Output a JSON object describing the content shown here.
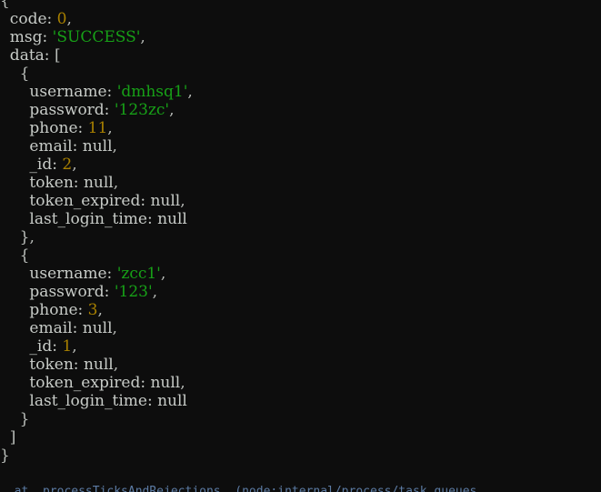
{
  "terminal": {
    "background_color": "#0d0d0d",
    "key_color": "#c8ccc8",
    "string_color": "#17a017",
    "number_color": "#a88000",
    "punctuation_color": "#b9bdb9",
    "clipped_line_color": "#6a8fbf"
  },
  "response": {
    "open_brace": "{",
    "close_brace": "}",
    "code": {
      "key": "  code:",
      "value": "0",
      "comma": ","
    },
    "msg": {
      "key": "  msg:",
      "quote_open": "'",
      "value": "SUCCESS",
      "quote_close": "'",
      "comma": ","
    },
    "data": {
      "key": "  data:",
      "open_bracket": "[",
      "close_bracket": "  ]",
      "records": [
        {
          "open_brace": "    {",
          "close_brace": "    },",
          "fields": [
            {
              "indent": "      ",
              "key": "username:",
              "value": "'dmhsq1'",
              "type": "string",
              "comma": ","
            },
            {
              "indent": "      ",
              "key": "password:",
              "value": "'123zc'",
              "type": "string",
              "comma": ","
            },
            {
              "indent": "      ",
              "key": "phone:",
              "value": "11",
              "type": "number",
              "comma": ","
            },
            {
              "indent": "      ",
              "key": "email:",
              "value": "null",
              "type": "null",
              "comma": ","
            },
            {
              "indent": "      ",
              "key": "_id:",
              "value": "2",
              "type": "number",
              "comma": ","
            },
            {
              "indent": "      ",
              "key": "token:",
              "value": "null",
              "type": "null",
              "comma": ","
            },
            {
              "indent": "      ",
              "key": "token_expired:",
              "value": "null",
              "type": "null",
              "comma": ","
            },
            {
              "indent": "      ",
              "key": "last_login_time:",
              "value": "null",
              "type": "null",
              "comma": ""
            }
          ]
        },
        {
          "open_brace": "    {",
          "close_brace": "    }",
          "fields": [
            {
              "indent": "      ",
              "key": "username:",
              "value": "'zcc1'",
              "type": "string",
              "comma": ","
            },
            {
              "indent": "      ",
              "key": "password:",
              "value": "'123'",
              "type": "string",
              "comma": ","
            },
            {
              "indent": "      ",
              "key": "phone:",
              "value": "3",
              "type": "number",
              "comma": ","
            },
            {
              "indent": "      ",
              "key": "email:",
              "value": "null",
              "type": "null",
              "comma": ","
            },
            {
              "indent": "      ",
              "key": "_id:",
              "value": "1",
              "type": "number",
              "comma": ","
            },
            {
              "indent": "      ",
              "key": "token:",
              "value": "null",
              "type": "null",
              "comma": ","
            },
            {
              "indent": "      ",
              "key": "token_expired:",
              "value": "null",
              "type": "null",
              "comma": ","
            },
            {
              "indent": "      ",
              "key": "last_login_time:",
              "value": "null",
              "type": "null",
              "comma": ""
            }
          ]
        }
      ]
    }
  },
  "lines": [
    {
      "id": "l0",
      "parts": [
        {
          "t": "{",
          "c": "brace"
        }
      ]
    },
    {
      "id": "l1",
      "parts": [
        {
          "t": "  code: ",
          "c": "key"
        },
        {
          "t": "0",
          "c": "num"
        },
        {
          "t": ",",
          "c": "punc"
        }
      ]
    },
    {
      "id": "l2",
      "parts": [
        {
          "t": "  msg: ",
          "c": "key"
        },
        {
          "t": "'SUCCESS'",
          "c": "str"
        },
        {
          "t": ",",
          "c": "punc"
        }
      ]
    },
    {
      "id": "l3",
      "parts": [
        {
          "t": "  data: ",
          "c": "key"
        },
        {
          "t": "[",
          "c": "brace"
        }
      ]
    },
    {
      "id": "l4",
      "parts": [
        {
          "t": "    {",
          "c": "brace"
        }
      ]
    },
    {
      "id": "l5",
      "parts": [
        {
          "t": "      username: ",
          "c": "key"
        },
        {
          "t": "'dmhsq1'",
          "c": "str"
        },
        {
          "t": ",",
          "c": "punc"
        }
      ]
    },
    {
      "id": "l6",
      "parts": [
        {
          "t": "      password: ",
          "c": "key"
        },
        {
          "t": "'123zc'",
          "c": "str"
        },
        {
          "t": ",",
          "c": "punc"
        }
      ]
    },
    {
      "id": "l7",
      "parts": [
        {
          "t": "      phone: ",
          "c": "key"
        },
        {
          "t": "11",
          "c": "num"
        },
        {
          "t": ",",
          "c": "punc"
        }
      ]
    },
    {
      "id": "l8",
      "parts": [
        {
          "t": "      email: ",
          "c": "key"
        },
        {
          "t": "null",
          "c": "nul"
        },
        {
          "t": ",",
          "c": "punc"
        }
      ]
    },
    {
      "id": "l9",
      "parts": [
        {
          "t": "      _id: ",
          "c": "key"
        },
        {
          "t": "2",
          "c": "num"
        },
        {
          "t": ",",
          "c": "punc"
        }
      ]
    },
    {
      "id": "l10",
      "parts": [
        {
          "t": "      token: ",
          "c": "key"
        },
        {
          "t": "null",
          "c": "nul"
        },
        {
          "t": ",",
          "c": "punc"
        }
      ]
    },
    {
      "id": "l11",
      "parts": [
        {
          "t": "      token_expired: ",
          "c": "key"
        },
        {
          "t": "null",
          "c": "nul"
        },
        {
          "t": ",",
          "c": "punc"
        }
      ]
    },
    {
      "id": "l12",
      "parts": [
        {
          "t": "      last_login_time: ",
          "c": "key"
        },
        {
          "t": "null",
          "c": "nul"
        }
      ]
    },
    {
      "id": "l13",
      "parts": [
        {
          "t": "    }",
          "c": "brace"
        },
        {
          "t": ",",
          "c": "punc"
        }
      ]
    },
    {
      "id": "l14",
      "parts": [
        {
          "t": "    {",
          "c": "brace"
        }
      ]
    },
    {
      "id": "l15",
      "parts": [
        {
          "t": "      username: ",
          "c": "key"
        },
        {
          "t": "'zcc1'",
          "c": "str"
        },
        {
          "t": ",",
          "c": "punc"
        }
      ]
    },
    {
      "id": "l16",
      "parts": [
        {
          "t": "      password: ",
          "c": "key"
        },
        {
          "t": "'123'",
          "c": "str"
        },
        {
          "t": ",",
          "c": "punc"
        }
      ]
    },
    {
      "id": "l17",
      "parts": [
        {
          "t": "      phone: ",
          "c": "key"
        },
        {
          "t": "3",
          "c": "num"
        },
        {
          "t": ",",
          "c": "punc"
        }
      ]
    },
    {
      "id": "l18",
      "parts": [
        {
          "t": "      email: ",
          "c": "key"
        },
        {
          "t": "null",
          "c": "nul"
        },
        {
          "t": ",",
          "c": "punc"
        }
      ]
    },
    {
      "id": "l19",
      "parts": [
        {
          "t": "      _id: ",
          "c": "key"
        },
        {
          "t": "1",
          "c": "num"
        },
        {
          "t": ",",
          "c": "punc"
        }
      ]
    },
    {
      "id": "l20",
      "parts": [
        {
          "t": "      token: ",
          "c": "key"
        },
        {
          "t": "null",
          "c": "nul"
        },
        {
          "t": ",",
          "c": "punc"
        }
      ]
    },
    {
      "id": "l21",
      "parts": [
        {
          "t": "      token_expired: ",
          "c": "key"
        },
        {
          "t": "null",
          "c": "nul"
        },
        {
          "t": ",",
          "c": "punc"
        }
      ]
    },
    {
      "id": "l22",
      "parts": [
        {
          "t": "      last_login_time: ",
          "c": "key"
        },
        {
          "t": "null",
          "c": "nul"
        }
      ]
    },
    {
      "id": "l23",
      "parts": [
        {
          "t": "    }",
          "c": "brace"
        }
      ]
    },
    {
      "id": "l24",
      "parts": [
        {
          "t": "  ]",
          "c": "brace"
        }
      ]
    },
    {
      "id": "l25",
      "parts": [
        {
          "t": "}",
          "c": "brace"
        }
      ]
    }
  ],
  "clipped_bottom_line": "  at  processTicksAndRejections  (node:internal/process/task_queues"
}
